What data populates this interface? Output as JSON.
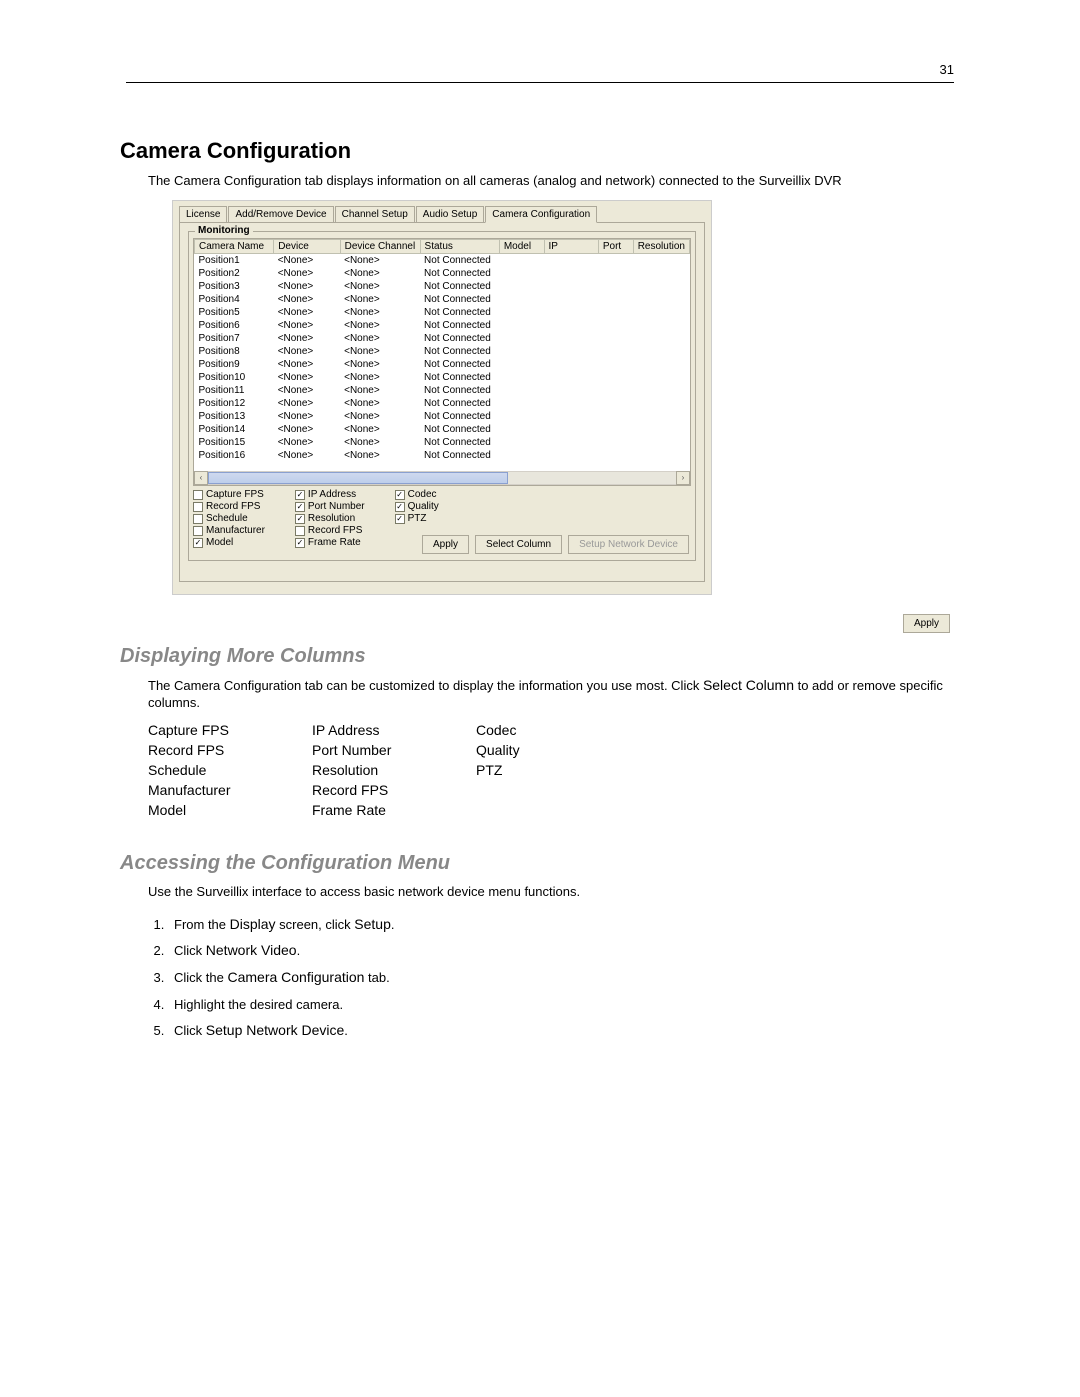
{
  "page_number": "31",
  "section_title": "Camera Configuration",
  "intro_text": "The Camera Configuration tab displays information on all cameras (analog and network) connected to the Surveillix DVR",
  "tabs": {
    "license": "License",
    "add_remove": "Add/Remove Device",
    "channel_setup": "Channel Setup",
    "audio_setup": "Audio Setup",
    "camera_config": "Camera Configuration"
  },
  "group_label": "Monitoring",
  "columns": {
    "camera_name": "Camera Name",
    "device": "Device",
    "device_channel": "Device Channel",
    "status": "Status",
    "model": "Model",
    "ip": "IP",
    "port": "Port",
    "resolution": "Resolution"
  },
  "rows": [
    {
      "name": "Position1",
      "device": "<None>",
      "channel": "<None>",
      "status": "Not Connected"
    },
    {
      "name": "Position2",
      "device": "<None>",
      "channel": "<None>",
      "status": "Not Connected"
    },
    {
      "name": "Position3",
      "device": "<None>",
      "channel": "<None>",
      "status": "Not Connected"
    },
    {
      "name": "Position4",
      "device": "<None>",
      "channel": "<None>",
      "status": "Not Connected"
    },
    {
      "name": "Position5",
      "device": "<None>",
      "channel": "<None>",
      "status": "Not Connected"
    },
    {
      "name": "Position6",
      "device": "<None>",
      "channel": "<None>",
      "status": "Not Connected"
    },
    {
      "name": "Position7",
      "device": "<None>",
      "channel": "<None>",
      "status": "Not Connected"
    },
    {
      "name": "Position8",
      "device": "<None>",
      "channel": "<None>",
      "status": "Not Connected"
    },
    {
      "name": "Position9",
      "device": "<None>",
      "channel": "<None>",
      "status": "Not Connected"
    },
    {
      "name": "Position10",
      "device": "<None>",
      "channel": "<None>",
      "status": "Not Connected"
    },
    {
      "name": "Position11",
      "device": "<None>",
      "channel": "<None>",
      "status": "Not Connected"
    },
    {
      "name": "Position12",
      "device": "<None>",
      "channel": "<None>",
      "status": "Not Connected"
    },
    {
      "name": "Position13",
      "device": "<None>",
      "channel": "<None>",
      "status": "Not Connected"
    },
    {
      "name": "Position14",
      "device": "<None>",
      "channel": "<None>",
      "status": "Not Connected"
    },
    {
      "name": "Position15",
      "device": "<None>",
      "channel": "<None>",
      "status": "Not Connected"
    },
    {
      "name": "Position16",
      "device": "<None>",
      "channel": "<None>",
      "status": "Not Connected"
    }
  ],
  "checks": {
    "col1": [
      {
        "label": "Capture FPS",
        "checked": false
      },
      {
        "label": "Record FPS",
        "checked": false
      },
      {
        "label": "Schedule",
        "checked": false
      },
      {
        "label": "Manufacturer",
        "checked": false
      },
      {
        "label": "Model",
        "checked": true
      }
    ],
    "col2": [
      {
        "label": "IP Address",
        "checked": true
      },
      {
        "label": "Port Number",
        "checked": true
      },
      {
        "label": "Resolution",
        "checked": true
      },
      {
        "label": "Record FPS",
        "checked": false
      },
      {
        "label": "Frame Rate",
        "checked": true
      }
    ],
    "col3": [
      {
        "label": "Codec",
        "checked": true
      },
      {
        "label": "Quality",
        "checked": true
      },
      {
        "label": "PTZ",
        "checked": true
      }
    ]
  },
  "buttons": {
    "apply_inner": "Apply",
    "select_column": "Select Column",
    "setup_network": "Setup Network Device",
    "apply_outer": "Apply"
  },
  "sub1_title": "Displaying More Columns",
  "sub1_text_a": "The Camera Configuration tab can be customized to display the information you use most.  Click ",
  "sub1_text_b": "Select Column",
  "sub1_text_c": " to add or remove specific columns.",
  "column_options": {
    "c1": [
      "Capture FPS",
      "Record FPS",
      "Schedule",
      "Manufacturer",
      "Model"
    ],
    "c2": [
      "IP Address",
      "Port Number",
      "Resolution",
      "Record FPS",
      "Frame Rate"
    ],
    "c3": [
      "Codec",
      "Quality",
      "PTZ"
    ]
  },
  "sub2_title": "Accessing the Configuration Menu",
  "sub2_intro": "Use the Surveillix interface to access basic network device menu functions.",
  "steps": [
    {
      "pre": "From the ",
      "em1": "Display",
      "mid": " screen, click ",
      "em2": "Setup",
      "post": "."
    },
    {
      "pre": "Click ",
      "em1": "Network Video",
      "mid": "",
      "em2": "",
      "post": "."
    },
    {
      "pre": "Click the ",
      "em1": "Camera Configuration",
      "mid": " tab.",
      "em2": "",
      "post": ""
    },
    {
      "pre": "Highlight the desired camera.",
      "em1": "",
      "mid": "",
      "em2": "",
      "post": ""
    },
    {
      "pre": "Click ",
      "em1": "Setup Network Device",
      "mid": "",
      "em2": "",
      "post": "."
    }
  ]
}
